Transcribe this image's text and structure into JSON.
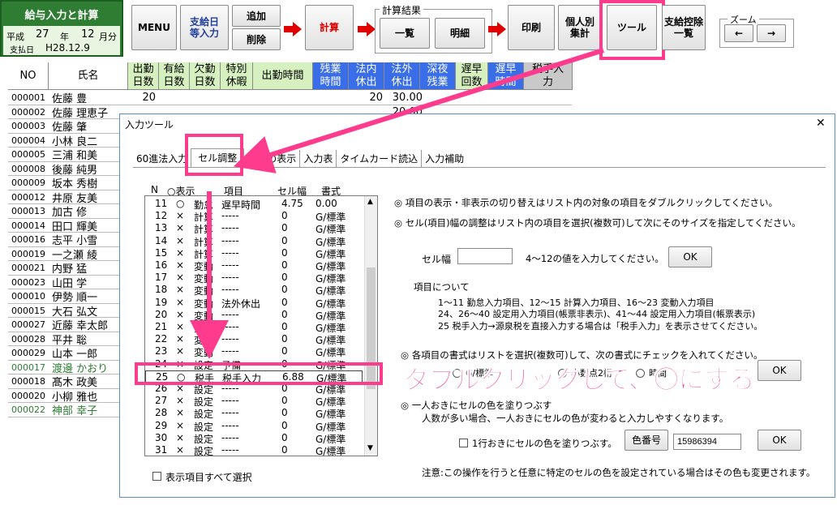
{
  "title_box": {
    "title": "給与入力と計算",
    "era": "平成",
    "year": "27",
    "year_unit": "年",
    "month": "12",
    "month_unit": "月分",
    "pay_label": "支払日",
    "pay_date": "H28.12.9"
  },
  "toolbar": {
    "menu": "MENU",
    "pay_input": "支給日\n等入力",
    "add": "追加",
    "delete": "削除",
    "calc": "計算",
    "calc_result_label": "計算結果",
    "list": "一覧",
    "detail": "明細",
    "print": "印刷",
    "by_person": "個人別\n集計",
    "tool": "ツール",
    "deduction_list": "支給控除\n一覧",
    "zoom_label": "ズーム",
    "zoom_left": "←",
    "zoom_right": "→"
  },
  "columns": [
    "NO",
    "氏名",
    "出勤\n日数",
    "有給\n日数",
    "欠勤\n日数",
    "特別\n休暇",
    "出勤時間",
    "残業\n時間",
    "法内\n休出",
    "法外\n休出",
    "深夜\n残業",
    "遅早\n回数",
    "遅早\n時間",
    "税手入\n力"
  ],
  "employees": [
    {
      "no": "000001",
      "name": "佐藤 豊",
      "v1": "20",
      "v2": "20",
      "v3": "30.00",
      "green": false
    },
    {
      "no": "000002",
      "name": "佐藤 理恵子",
      "v1": "",
      "v2": "",
      "v3": "20.00",
      "green": false
    },
    {
      "no": "000003",
      "name": "佐藤 肇",
      "green": false
    },
    {
      "no": "000004",
      "name": "小林 良二",
      "green": false
    },
    {
      "no": "000005",
      "name": "三浦 和美",
      "green": false
    },
    {
      "no": "000008",
      "name": "後藤 純男",
      "green": false
    },
    {
      "no": "000009",
      "name": "坂本 秀樹",
      "green": false
    },
    {
      "no": "000012",
      "name": "井原 友美",
      "green": false
    },
    {
      "no": "000013",
      "name": "加古 修",
      "green": false
    },
    {
      "no": "000014",
      "name": "田口 輝美",
      "green": false
    },
    {
      "no": "000016",
      "name": "志平 小雪",
      "green": false
    },
    {
      "no": "000019",
      "name": "一之瀬 綾",
      "green": false
    },
    {
      "no": "000021",
      "name": "内野 猛",
      "green": false
    },
    {
      "no": "000023",
      "name": "山田 学",
      "green": false
    },
    {
      "no": "000010",
      "name": "伊勢 順一",
      "green": false
    },
    {
      "no": "000015",
      "name": "大石 弘文",
      "green": false
    },
    {
      "no": "000027",
      "name": "近藤 幸太郎",
      "green": false
    },
    {
      "no": "000028",
      "name": "平井 聡",
      "green": false
    },
    {
      "no": "000029",
      "name": "山本 一郎",
      "green": false
    },
    {
      "no": "000017",
      "name": "渡邊 かおり",
      "green": true
    },
    {
      "no": "000018",
      "name": "髙木 政美",
      "green": false
    },
    {
      "no": "000020",
      "name": "小柳 雅也",
      "green": false
    },
    {
      "no": "000022",
      "name": "神部 幸子",
      "green": true
    }
  ],
  "dialog": {
    "title": "入力ツール",
    "close": "✕",
    "tabs": [
      "60進法入力",
      "セル調整",
      "項目の表示",
      "入力表",
      "タイムカード読込",
      "入力補助"
    ],
    "list_header": {
      "n": "N",
      "show": "○表示",
      "item": "項目",
      "width": "セル幅",
      "format": "書式"
    },
    "list_rows": [
      {
        "n": "11",
        "mark": "○",
        "cat": "勤怠",
        "item": "遅早時間",
        "w": "4.75",
        "f": "0.00"
      },
      {
        "n": "12",
        "mark": "×",
        "cat": "計算",
        "item": "-----",
        "w": "0",
        "f": "G/標準"
      },
      {
        "n": "13",
        "mark": "×",
        "cat": "計算",
        "item": "-----",
        "w": "0",
        "f": "G/標準"
      },
      {
        "n": "14",
        "mark": "×",
        "cat": "計算",
        "item": "-----",
        "w": "0",
        "f": "G/標準"
      },
      {
        "n": "15",
        "mark": "×",
        "cat": "計算",
        "item": "-----",
        "w": "0",
        "f": "G/標準"
      },
      {
        "n": "16",
        "mark": "×",
        "cat": "変動",
        "item": "-----",
        "w": "0",
        "f": "G/標準"
      },
      {
        "n": "17",
        "mark": "×",
        "cat": "変動",
        "item": "-----",
        "w": "0",
        "f": "G/標準"
      },
      {
        "n": "18",
        "mark": "×",
        "cat": "変動",
        "item": "-----",
        "w": "0",
        "f": "G/標準"
      },
      {
        "n": "19",
        "mark": "×",
        "cat": "変動",
        "item": "法外休出",
        "w": "0",
        "f": "G/標準"
      },
      {
        "n": "20",
        "mark": "×",
        "cat": "変動",
        "item": "-----",
        "w": "0",
        "f": "G/標準"
      },
      {
        "n": "21",
        "mark": "×",
        "cat": "変動",
        "item": "-----",
        "w": "0",
        "f": "G/標準"
      },
      {
        "n": "22",
        "mark": "×",
        "cat": "変動",
        "item": "-----",
        "w": "0",
        "f": "G/標準"
      },
      {
        "n": "23",
        "mark": "×",
        "cat": "変動",
        "item": "-----",
        "w": "0",
        "f": "G/標準"
      },
      {
        "n": "24",
        "mark": "×",
        "cat": "設定",
        "item": "予備",
        "w": "0",
        "f": "G/標準"
      },
      {
        "n": "25",
        "mark": "○",
        "cat": "税手",
        "item": "税手入力",
        "w": "6.88",
        "f": "G/標準"
      },
      {
        "n": "26",
        "mark": "×",
        "cat": "設定",
        "item": "-----",
        "w": "0",
        "f": "G/標準"
      },
      {
        "n": "27",
        "mark": "×",
        "cat": "設定",
        "item": "-----",
        "w": "0",
        "f": "G/標準"
      },
      {
        "n": "28",
        "mark": "×",
        "cat": "設定",
        "item": "-----",
        "w": "0",
        "f": "G/標準"
      },
      {
        "n": "29",
        "mark": "×",
        "cat": "設定",
        "item": "-----",
        "w": "0",
        "f": "G/標準"
      },
      {
        "n": "30",
        "mark": "×",
        "cat": "設定",
        "item": "-----",
        "w": "0",
        "f": "G/標準"
      },
      {
        "n": "31",
        "mark": "×",
        "cat": "設定",
        "item": "-----",
        "w": "0",
        "f": "G/標準"
      }
    ],
    "select_all": "表示項目すべて選択",
    "note1": "◎ 項目の表示・非表示の切り替えはリスト内の対象の項目をダブルクリックしてください。",
    "note2": "◎ セル(項目)幅の調整はリスト内の項目を選択(複数可)して次にそのサイズを指定してください。",
    "cell_width_label": "セル幅",
    "cell_width_value": "",
    "cell_width_hint": "4～12の値を入力してください。",
    "ok": "OK",
    "items_about": "項目について",
    "items_l1": "1～11 勤怠入力項目、12～15 計算入力項目、16～23 変動入力項目",
    "items_l2": "24、26～40 設定用入力項目(帳票非表示)、41～44 設定用入力項目(帳票表示)",
    "items_l3": "25 税手入力→源泉税を直接入力する場合は「税手入力」を表示させてください。",
    "format_note": "◎ 各項目の書式はリストを選択(複数可)して、次の書式にチェックを入れてください。",
    "format_opt1": "G/標準",
    "format_opt2": "小数点2桁",
    "format_opt3": "時間",
    "alt_color_note": "◎ 一人おきにセルの色を塗りつぶす",
    "alt_color_sub": "人数が多い場合、一人おきにセルの色が変わると入力しやすくなります。",
    "alt_color_check": "1行おきにセルの色を塗りつぶす。",
    "color_no_label": "色番号",
    "color_no_value": "15986394",
    "warning": "注意:この操作を行うと任意に特定のセルの色を設定されている場合はその色も変更されます。"
  },
  "callout": "ダブルクリックして、〇にする",
  "colors": {
    "accent": "#ff3b8d",
    "red": "#e00000",
    "green_header": "#d6f0c0",
    "blue_header": "#3a6ee8"
  }
}
